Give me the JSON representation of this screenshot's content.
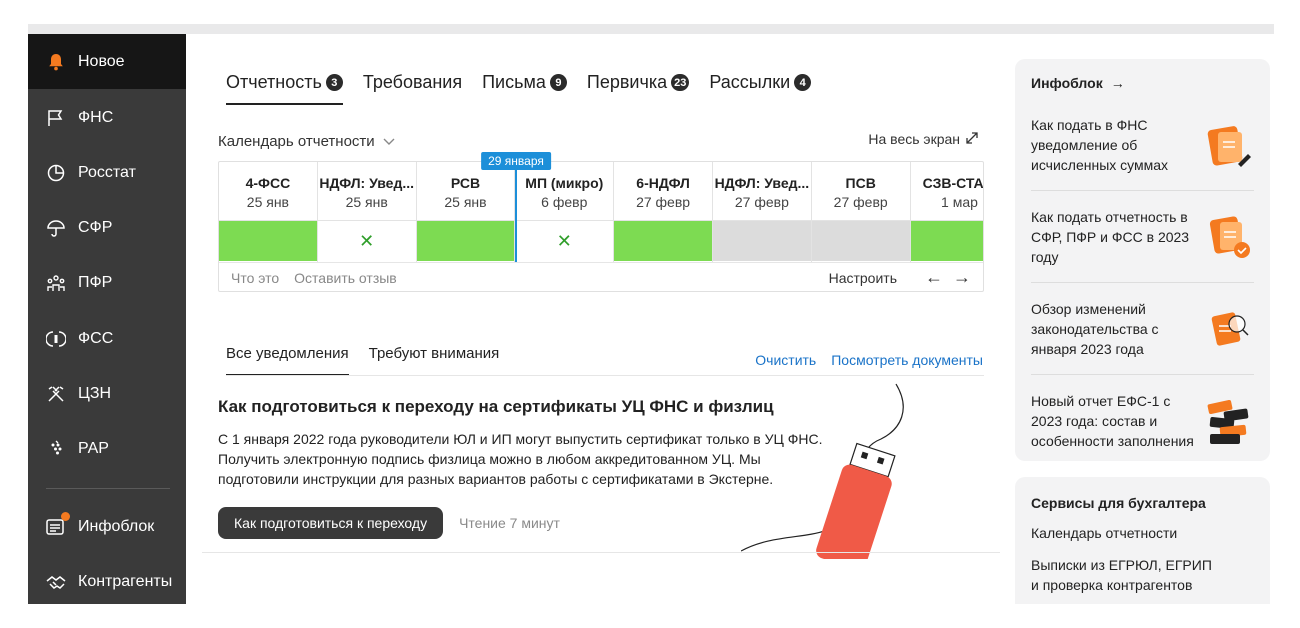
{
  "sidebar": {
    "items": [
      {
        "label": "Новое",
        "icon": "bell-icon",
        "active": true
      },
      {
        "label": "ФНС",
        "icon": "flag-icon"
      },
      {
        "label": "Росстат",
        "icon": "pie-chart-icon"
      },
      {
        "label": "СФР",
        "icon": "umbrella-icon"
      },
      {
        "label": "ПФР",
        "icon": "people-icon"
      },
      {
        "label": "ФСС",
        "icon": "fss-icon"
      },
      {
        "label": "ЦЗН",
        "icon": "tools-icon"
      },
      {
        "label": "РАР",
        "icon": "grapes-icon"
      },
      {
        "label": "Инфоблок",
        "icon": "news-icon"
      },
      {
        "label": "Контрагенты",
        "icon": "handshake-icon"
      }
    ]
  },
  "tabs": [
    {
      "label": "Отчетность",
      "count": "3",
      "active": true
    },
    {
      "label": "Требования",
      "count": ""
    },
    {
      "label": "Письма",
      "count": "9"
    },
    {
      "label": "Первичка",
      "count": "23"
    },
    {
      "label": "Рассылки",
      "count": "4"
    }
  ],
  "calendar": {
    "title": "Календарь отчетности",
    "fullscreen": "На весь экран",
    "today": "29 января",
    "columns": [
      {
        "name": "4-ФСС",
        "date": "25 янв",
        "status": "green"
      },
      {
        "name": "НДФЛ: Увед...",
        "date": "25 янв",
        "status": "x"
      },
      {
        "name": "РСВ",
        "date": "25 янв",
        "status": "green"
      },
      {
        "name": "МП (микро)",
        "date": "6 февр",
        "status": "x"
      },
      {
        "name": "6-НДФЛ",
        "date": "27 февр",
        "status": "green"
      },
      {
        "name": "НДФЛ: Увед...",
        "date": "27 февр",
        "status": "gray"
      },
      {
        "name": "ПСВ",
        "date": "27 февр",
        "status": "gray"
      },
      {
        "name": "СЗВ-СТАЖ",
        "date": "1 мар",
        "status": "green"
      }
    ],
    "what": "Что это",
    "feedback": "Оставить отзыв",
    "configure": "Настроить"
  },
  "notifications": {
    "tabs": [
      "Все уведомления",
      "Требуют внимания"
    ],
    "clear": "Очистить",
    "view_docs": "Посмотреть документы"
  },
  "article": {
    "title": "Как подготовиться к переходу на сертификаты УЦ ФНС и физлиц",
    "text": "С 1 января 2022 года руководители ЮЛ и ИП могут выпустить сертификат только в УЦ ФНС. Получить электронную подпись физлица можно в любом аккредитованном УЦ. Мы подготовили инструкции для разных вариантов работы с сертификатами в Экстерне.",
    "button": "Как подготовиться к переходу",
    "read_time": "Чтение 7 минут"
  },
  "infoblock": {
    "title": "Инфоблок",
    "items": [
      "Как подать в ФНС уведомление об исчисленных суммах",
      "Как подать отчетность в СФР, ПФР и ФСС в 2023 году",
      "Обзор изменений законодательства с января 2023 года",
      "Новый отчет ЕФС-1 с 2023 года: состав и особенности заполнения"
    ]
  },
  "services": {
    "title": "Сервисы для бухгалтера",
    "items": [
      "Календарь отчетности",
      "Выписки из ЕГРЮЛ, ЕГРИП и проверка контрагентов"
    ]
  },
  "colors": {
    "accent_green": "#7ddb52",
    "link_blue": "#1a73c8",
    "today_blue": "#1c8fd9",
    "orange": "#f47a20"
  }
}
